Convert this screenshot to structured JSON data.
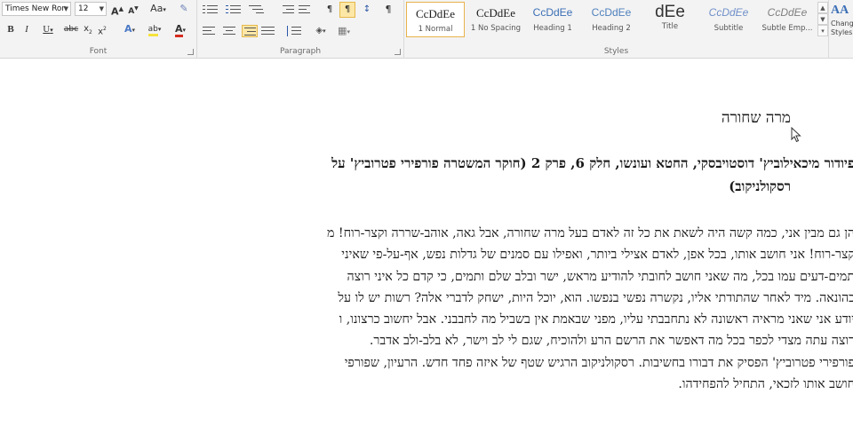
{
  "font": {
    "name": "Times New Ron",
    "size": "12",
    "grow_label": "A",
    "shrink_label": "A",
    "case_label": "Aa",
    "bold": "B",
    "italic": "I",
    "underline": "U",
    "strike": "abc",
    "subscript": "x",
    "superscript": "x",
    "effects": "A",
    "highlight": "ab",
    "color": "A",
    "group_label": "Font"
  },
  "paragraph": {
    "pilcrow": "¶",
    "group_label": "Paragraph"
  },
  "styles": {
    "group_label": "Styles",
    "change_label": "Change Styles",
    "items": [
      {
        "preview": "CcDdEe",
        "name": "1 Normal"
      },
      {
        "preview": "CcDdEe",
        "name": "1 No Spacing"
      },
      {
        "preview": "CcDdEe",
        "name": "Heading 1"
      },
      {
        "preview": "CcDdEe",
        "name": "Heading 2"
      },
      {
        "preview": "dEe",
        "name": "Title"
      },
      {
        "preview": "CcDdEe",
        "name": "Subtitle"
      },
      {
        "preview": "CcDdEe",
        "name": "Subtle Emp..."
      }
    ]
  },
  "colors": {
    "highlight": "#f5e23a",
    "font_color": "#d62b1f",
    "heading1": "#3b6fb6",
    "selected_style": "#e8b34c"
  },
  "document": {
    "title": "מרה שחורה",
    "heading_lines": [
      "פיודור מיכאילוביץ' דוסטויבסקי, החטא ועונשו, חלק 6, פרק 2 (חוקר המשטרה פורפירי פטרוביץ' על",
      "רסקולניקוב)"
    ],
    "body_lines": [
      "הן גם מבין אני, כמה קשה היה לשאת את כל זה לאדם בעל מרה שחורה, אבל גאה, אוהב-שררה וקצר-רוח! מ",
      "קצר-רוח! אני חושב אותו, בכל אפן, לאדם אצילי ביותר, ואפילו עם סמנים של גדלות נפש, אף-על-פי שאיני",
      "תמים-דעים עמו בכל, מה שאני חושב לחובתי להודיע מראש, ישר ובלב שלם ותמים, כי קדם כל איני רוצה",
      "בהונאה. מיד לאחר שהתודתי אליו, נקשרה נפשי בנפשו. הוא, יוכל היות, ישחק לדברי אלה? רשות יש לו על",
      "יודע אני שאני מראיה ראשונה לא נתחבבתי עליו, מפני שבאמת אין בשביל מה לחבבני. אבל יחשוב כרצונו, ו",
      "רוצה עתה מצדי לכפר בכל מה דאפשר את הרשם הרע ולהוכיח, שגם לי לב וישר, לא בלב-ולב אדבר.",
      "פורפירי פטרוביץ' הפסיק את דבורו בחשיבות. רסקולניקוב הרגיש שטף של איזה פחד חדש. הרעיון, שפורפי",
      "חושב אותו לזכאי, התחיל להפחידהו."
    ]
  }
}
